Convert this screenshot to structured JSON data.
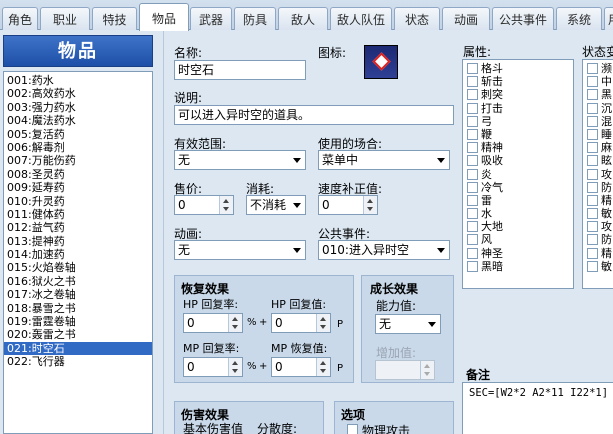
{
  "tabs": [
    "角色",
    "职业",
    "特技",
    "物品",
    "武器",
    "防具",
    "敌人",
    "敌人队伍",
    "状态",
    "动画",
    "公共事件",
    "系统",
    "用"
  ],
  "active_tab": 3,
  "list_title": "物品",
  "items": [
    "001:药水",
    "002:高效药水",
    "003:强力药水",
    "004:魔法药水",
    "005:复活药",
    "006:解毒剂",
    "007:万能伤药",
    "008:圣灵药",
    "009:延寿药",
    "010:升灵药",
    "011:健体药",
    "012:益气药",
    "013:提神药",
    "014:加速药",
    "015:火焰卷轴",
    "016:狱火之书",
    "017:冰之卷轴",
    "018:暴雪之书",
    "019:雷霆卷轴",
    "020:轰雷之书",
    "021:时空石",
    "022:飞行器"
  ],
  "selected_item": 20,
  "form": {
    "name_label": "名称:",
    "name_value": "时空石",
    "icon_label": "图标:",
    "desc_label": "说明:",
    "desc_value": "可以进入异时空的道具。",
    "scope_label": "有效范围:",
    "scope_value": "无",
    "occasion_label": "使用的场合:",
    "occasion_value": "菜单中",
    "price_label": "售价:",
    "price_value": "0",
    "consume_label": "消耗:",
    "consume_value": "不消耗",
    "speed_label": "速度补正值:",
    "speed_value": "0",
    "anim_label": "动画:",
    "anim_value": "无",
    "common_label": "公共事件:",
    "common_value": "010:进入异时空"
  },
  "recovery": {
    "title": "恢复效果",
    "hp_rate_label": "HP 回复率:",
    "hp_rate_value": "0",
    "hp_val_label": "HP 回复值:",
    "hp_val_value": "0",
    "mp_rate_label": "MP 回复率:",
    "mp_rate_value": "0",
    "mp_val_label": "MP 恢复值:",
    "mp_val_value": "0",
    "pct": "%",
    "plus": "+",
    "p": "P"
  },
  "growth": {
    "title": "成长效果",
    "stat_label": "能力值:",
    "stat_value": "无",
    "inc_label": "增加值:"
  },
  "damage": {
    "title": "伤害效果",
    "base_label": "基本伤害值",
    "var_label": "分散度:"
  },
  "options": {
    "title": "选项",
    "physical": "物理攻击"
  },
  "attributes": {
    "title": "属性:",
    "items": [
      "格斗",
      "斩击",
      "刺突",
      "打击",
      "弓",
      "鞭",
      "精神",
      "吸收",
      "炎",
      "冷气",
      "雷",
      "水",
      "大地",
      "风",
      "神圣",
      "黑暗"
    ]
  },
  "states": {
    "title": "状态变",
    "items": [
      "濒",
      "中",
      "黑",
      "沉",
      "混",
      "睡",
      "麻",
      "眩",
      "攻",
      "防",
      "精",
      "敏",
      "攻",
      "防",
      "精",
      "敏"
    ]
  },
  "note": {
    "title": "备注",
    "value": "SEC=[W2*2 A2*11 I22*1]"
  }
}
